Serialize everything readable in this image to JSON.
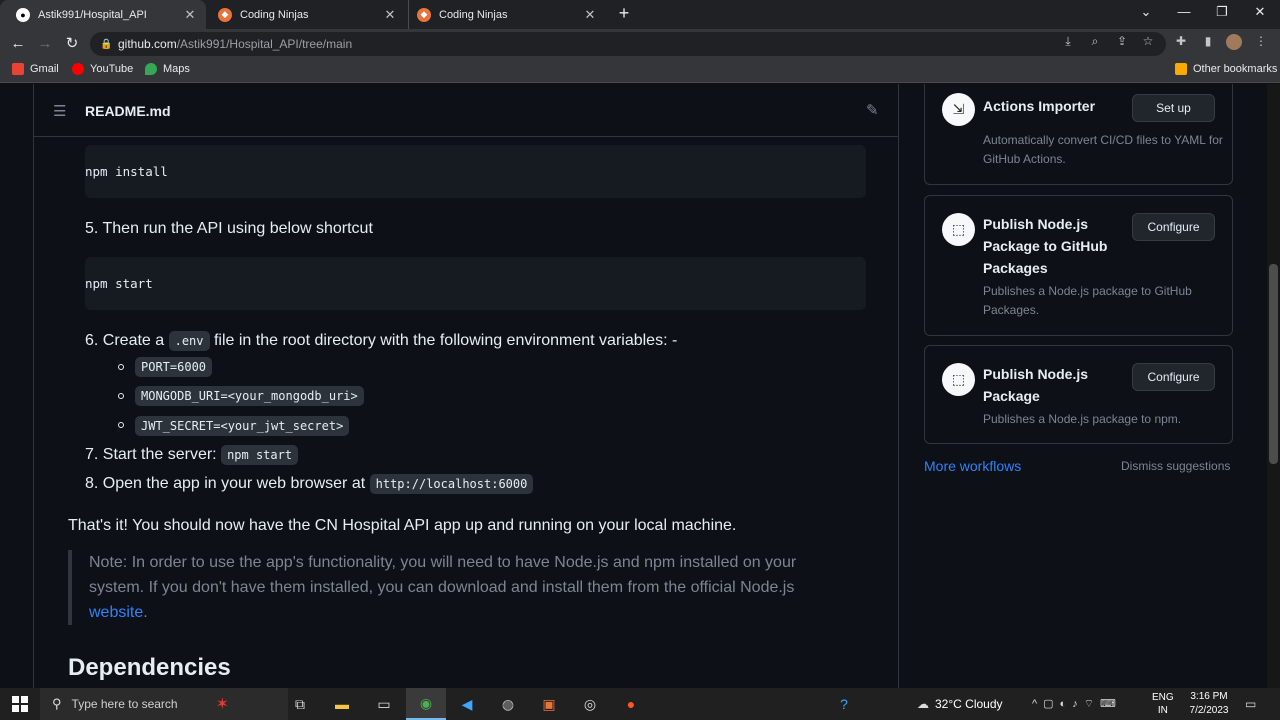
{
  "browser": {
    "tabs": [
      {
        "label": "Astik991/Hospital_API",
        "active": true,
        "icon": "github-icon"
      },
      {
        "label": "Coding Ninjas",
        "active": false,
        "icon": "coding-ninjas-icon"
      },
      {
        "label": "Coding Ninjas",
        "active": false,
        "icon": "coding-ninjas-icon"
      }
    ],
    "url_host": "github.com",
    "url_path": "/Astik991/Hospital_API/tree/main",
    "bookmarks": [
      "Gmail",
      "YouTube",
      "Maps"
    ],
    "other_bookmarks": "Other bookmarks"
  },
  "readme": {
    "title": "README.md",
    "code1": "npm install",
    "step5": "5. Then run the API using below shortcut",
    "code2": "npm start",
    "step6_pre": "6. Create a",
    "step6_code": ".env",
    "step6_post": "file in the root directory with the following environment variables: -",
    "env_vars": [
      "PORT=6000",
      "MONGODB_URI=<your_mongodb_uri>",
      "JWT_SECRET=<your_jwt_secret>"
    ],
    "step7_pre": "7. Start the server:",
    "step7_code": "npm start",
    "step8_pre": "8. Open the app in your web browser at",
    "step8_code": "http://localhost:6000",
    "closing": "That's it! You should now have the CN Hospital API app up and running on your local machine.",
    "note_line1": "Note: In order to use the app's functionality, you will need to have Node.js and npm installed on your",
    "note_line2": "system. If you don't have them installed, you can download and install them from the official Node.js",
    "note_link": "website",
    "note_end": ".",
    "dependencies_heading": "Dependencies"
  },
  "sidebar": {
    "cards": [
      {
        "title": "Actions Importer",
        "desc": "Automatically convert CI/CD files to YAML for GitHub Actions.",
        "button": "Set up"
      },
      {
        "title": "Publish Node.js Package to GitHub Packages",
        "desc": "Publishes a Node.js package to GitHub Packages.",
        "button": "Configure"
      },
      {
        "title": "Publish Node.js Package",
        "desc": "Publishes a Node.js package to npm.",
        "button": "Configure"
      }
    ],
    "more_workflows": "More workflows",
    "dismiss": "Dismiss suggestions"
  },
  "taskbar": {
    "search_placeholder": "Type here to search",
    "weather": "32°C  Cloudy",
    "lang_top": "ENG",
    "lang_bottom": "IN",
    "time": "3:16 PM",
    "date": "7/2/2023"
  },
  "colors": {
    "accent_link": "#2f81f7",
    "bg": "#0d1117",
    "border": "#30363d"
  }
}
